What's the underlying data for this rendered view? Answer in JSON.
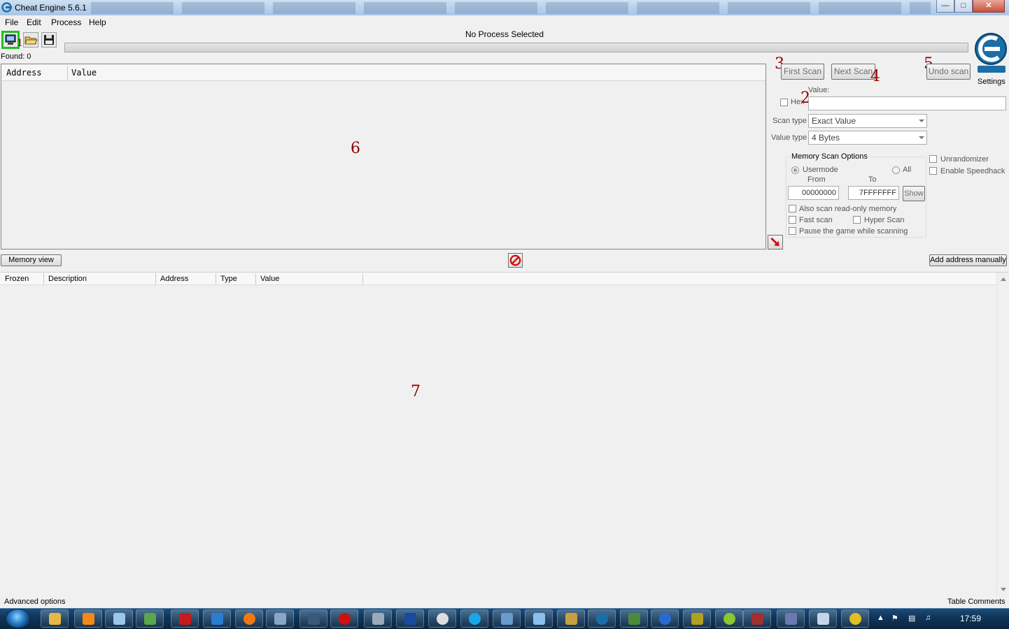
{
  "window": {
    "title": "Cheat Engine 5.6.1"
  },
  "menu": {
    "items": [
      "File",
      "Edit",
      "Process",
      "Help"
    ]
  },
  "toolbar": {
    "process_label": "No Process Selected",
    "found_label": "Found: 0"
  },
  "found_list": {
    "columns": [
      "Address",
      "Value"
    ]
  },
  "annotations": [
    "1",
    "2",
    "3",
    "4",
    "5",
    "6",
    "7"
  ],
  "scan": {
    "first_scan": "First Scan",
    "next_scan": "Next Scan",
    "undo_scan": "Undo scan",
    "settings": "Settings",
    "value_label": "Value:",
    "hex_label": "Hex",
    "scan_type_label": "Scan type",
    "scan_type_value": "Exact Value",
    "value_type_label": "Value type",
    "value_type_value": "4 Bytes"
  },
  "memory_options": {
    "title": "Memory Scan Options",
    "usermode": "Usermode",
    "all": "All",
    "from_label": "From",
    "to_label": "To",
    "from_value": "00000000",
    "to_value": "7FFFFFFF",
    "show": "Show",
    "readonly": "Also scan read-only memory",
    "fast_scan": "Fast scan",
    "hyper_scan": "Hyper Scan",
    "pause": "Pause the game while scanning"
  },
  "extras": {
    "unrandomizer": "Unrandomizer",
    "speedhack": "Enable Speedhack"
  },
  "buttons": {
    "memory_view": "Memory view",
    "add_address": "Add address manually"
  },
  "address_table": {
    "columns": [
      "Frozen",
      "Description",
      "Address",
      "Type",
      "Value"
    ]
  },
  "status": {
    "left": "Advanced options",
    "right": "Table Comments"
  },
  "taskbar": {
    "clock": "17:59"
  }
}
